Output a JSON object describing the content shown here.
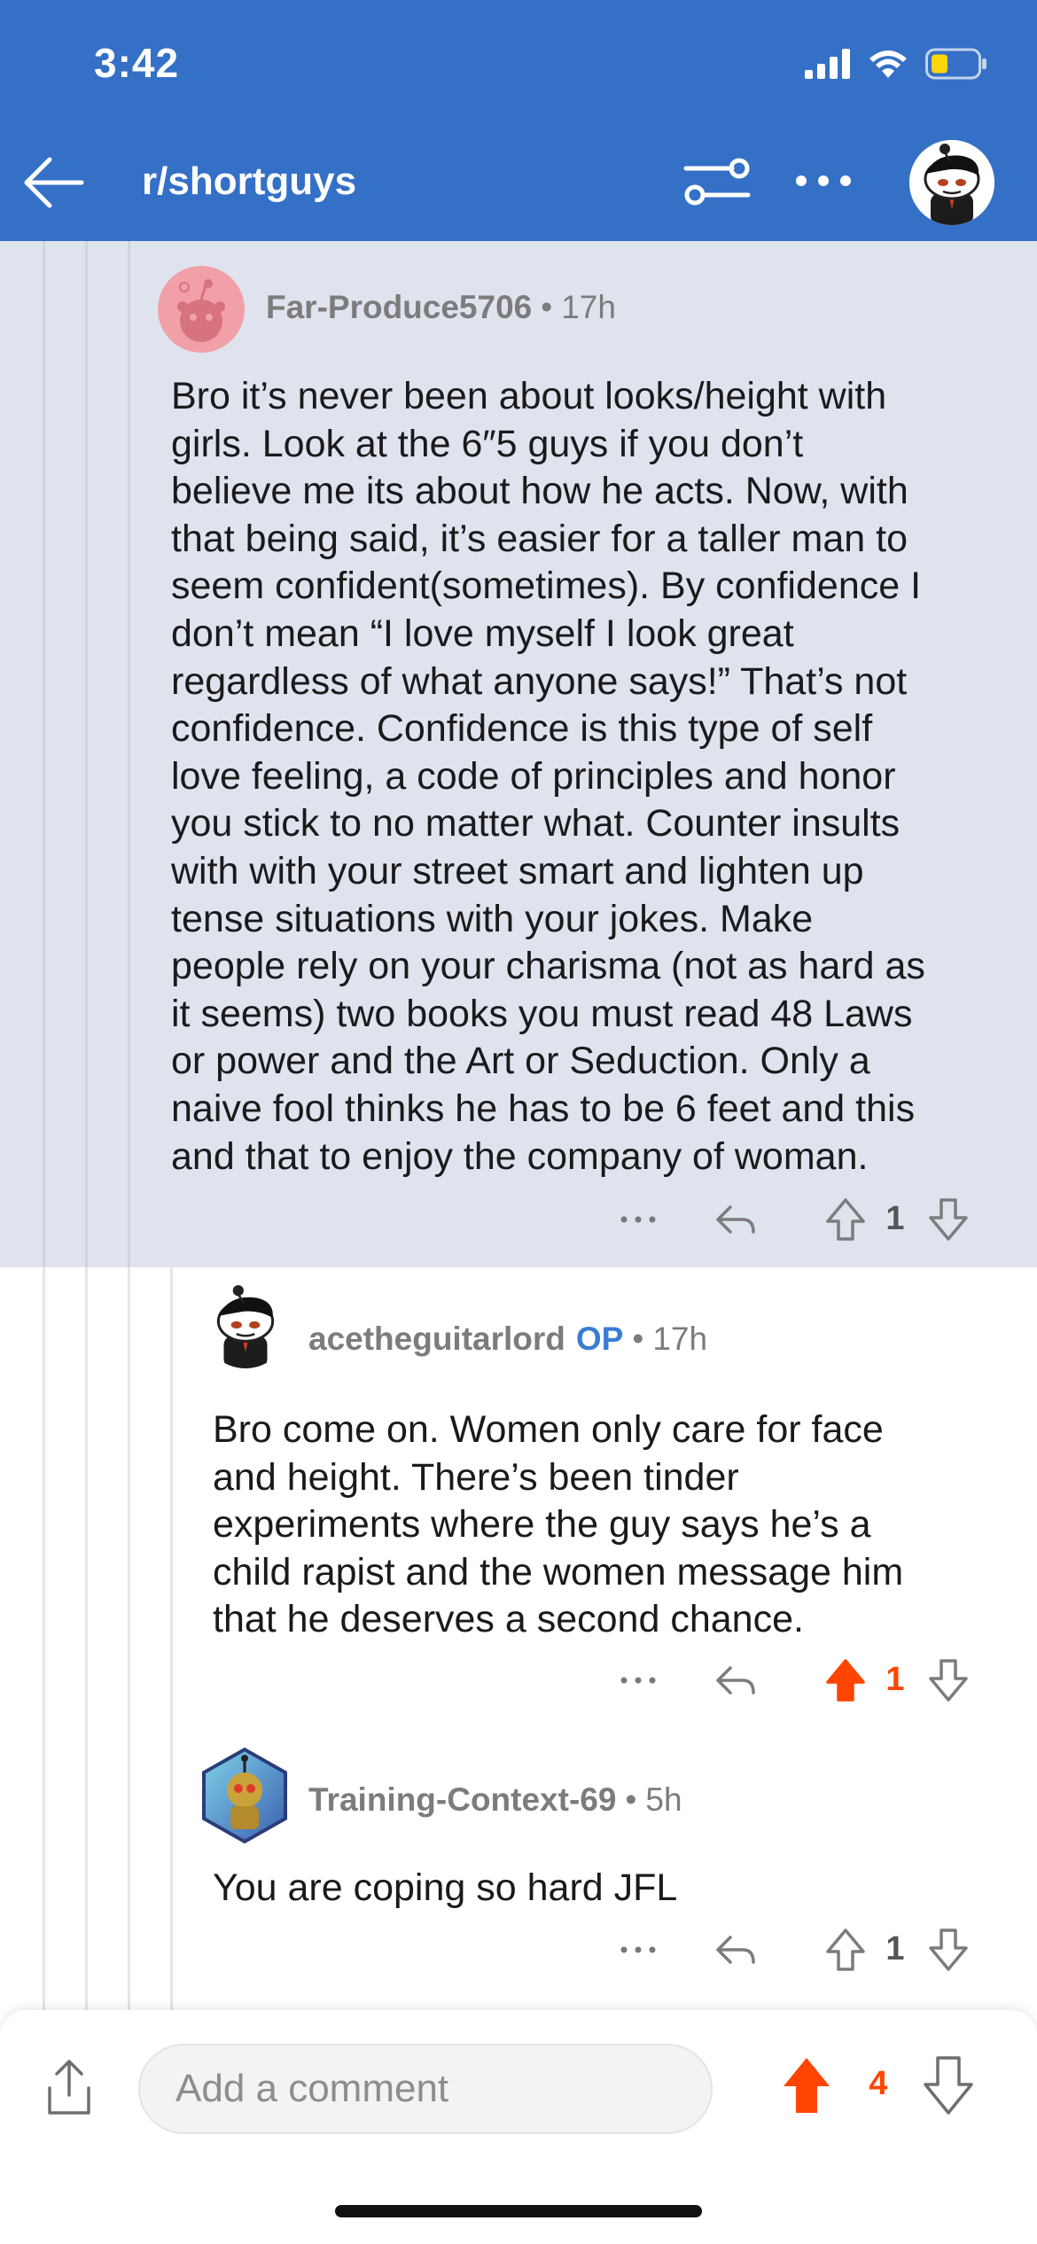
{
  "status_bar": {
    "time": "3:42"
  },
  "nav": {
    "title": "r/shortguys"
  },
  "comments": [
    {
      "username": "Far-Produce5706",
      "separator": "•",
      "time": "17h",
      "lines": [
        "Bro it’s never been about looks/height with",
        "girls. Look at the 6″5 guys if you don’t",
        "believe me its about how he acts. Now, with",
        "that being said, it’s easier for a taller man to",
        "seem confident(sometimes). By confidence I",
        "don’t mean “I love myself I look great",
        "regardless of what anyone says!” That’s not",
        "confidence. Confidence is this type of self",
        "love feeling, a code of principles and honor",
        "you stick to no matter what. Counter insults",
        "with with your street smart and lighten up",
        "tense situations with your jokes. Make",
        "people rely on your charisma (not as hard as",
        "it seems) two books you must read 48 Laws",
        "or power and the Art or Seduction. Only a",
        "naive fool thinks he has to be 6 feet and this",
        "and that to enjoy the company of woman."
      ],
      "score": "1",
      "upvoted": false
    },
    {
      "username": "acetheguitarlord",
      "flair": "OP",
      "separator": "•",
      "time": "17h",
      "lines": [
        "Bro come on. Women only care for face",
        "and height. There’s been tinder",
        "experiments where the guy says he’s a",
        "child rapist and the women message him",
        "that he deserves a second chance."
      ],
      "score": "1",
      "upvoted": true
    },
    {
      "username": "Training-Context-69",
      "separator": "•",
      "time": "5h",
      "lines": [
        "You are coping so hard JFL"
      ],
      "score": "1",
      "upvoted": false
    }
  ],
  "bottom_bar": {
    "comment_placeholder": "Add a comment",
    "post_score": "4",
    "post_upvoted": true
  },
  "colors": {
    "header_blue": "#3570c7",
    "highlight_bg": "#dfe3ee",
    "upvote_orange": "#ff4500",
    "op_blue": "#3a7bd5"
  }
}
